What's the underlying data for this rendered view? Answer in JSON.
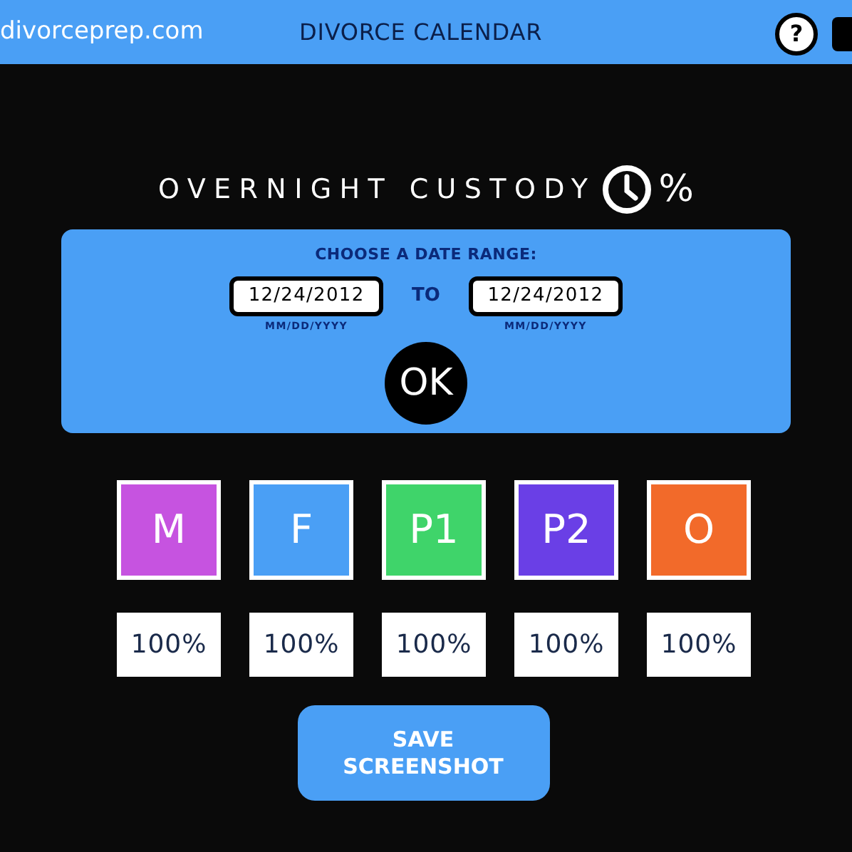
{
  "header": {
    "site": "divorceprep.com",
    "title": "DIVORCE CALENDAR",
    "help": "?"
  },
  "heading": {
    "label": "OVERNIGHT CUSTODY",
    "suffix": "%"
  },
  "date_range": {
    "label": "CHOOSE A DATE RANGE:",
    "from": {
      "value": "12/24/2012",
      "hint": "MM/DD/YYYY"
    },
    "separator": "TO",
    "to": {
      "value": "12/24/2012",
      "hint": "MM/DD/YYYY"
    },
    "ok": "OK"
  },
  "parties": [
    {
      "label": "M",
      "color": "#c653e0",
      "percent": "100%"
    },
    {
      "label": "F",
      "color": "#4a9ff5",
      "percent": "100%"
    },
    {
      "label": "P1",
      "color": "#3fd46a",
      "percent": "100%"
    },
    {
      "label": "P2",
      "color": "#6a3fe6",
      "percent": "100%"
    },
    {
      "label": "O",
      "color": "#f26a2a",
      "percent": "100%"
    }
  ],
  "save_button": "SAVE SCREENSHOT"
}
